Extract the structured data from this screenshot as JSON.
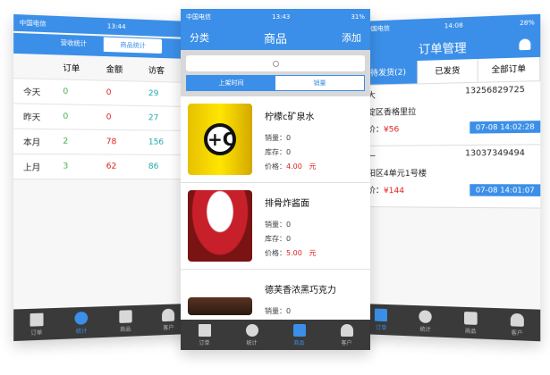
{
  "left": {
    "status": {
      "carrier": "中国电信",
      "time": "13:44"
    },
    "segment": [
      "营收统计",
      "商品统计"
    ],
    "header": [
      "",
      "订单",
      "金额",
      "访客"
    ],
    "rows": [
      {
        "label": "今天",
        "orders": "0",
        "amount": "0",
        "visitors": "29"
      },
      {
        "label": "昨天",
        "orders": "0",
        "amount": "0",
        "visitors": "27"
      },
      {
        "label": "本月",
        "orders": "2",
        "amount": "78",
        "visitors": "156"
      },
      {
        "label": "上月",
        "orders": "3",
        "amount": "62",
        "visitors": "86"
      }
    ],
    "tabs": [
      "订单",
      "统计",
      "商品",
      "客户"
    ]
  },
  "center": {
    "status": {
      "carrier": "中国电信",
      "time": "13:43",
      "battery": "31%"
    },
    "nav": {
      "left": "分类",
      "title": "商品",
      "right": "添加"
    },
    "segment": [
      "上架时间",
      "销量"
    ],
    "products": [
      {
        "name": "柠檬c矿泉水",
        "sales": "销量：0",
        "stock": "库存：0",
        "price_label": "价格：",
        "price": "4.00",
        "unit": "元"
      },
      {
        "name": "排骨炸酱面",
        "sales": "销量：0",
        "stock": "库存：0",
        "price_label": "价格：",
        "price": "5.00",
        "unit": "元"
      },
      {
        "name": "德芙香浓黑巧克力",
        "sales": "销量：0",
        "stock": "",
        "price_label": "",
        "price": "",
        "unit": ""
      }
    ],
    "tabs": [
      "订单",
      "统计",
      "商品",
      "客户"
    ]
  },
  "right": {
    "status": {
      "carrier": "中国电信",
      "time": "14:08",
      "battery": "28%"
    },
    "nav": {
      "title": "订单管理"
    },
    "tabs_top": [
      "待发货(2)",
      "已发货",
      "全部订单"
    ],
    "orders": [
      {
        "name": "王大",
        "phone": "13256829725",
        "addr": "海淀区香格里拉",
        "total_label": "总价：",
        "total": "¥56",
        "time": "07-08 14:02:28"
      },
      {
        "name": "张一",
        "phone": "13037349494",
        "addr": "朝阳区4单元1号楼",
        "total_label": "总价：",
        "total": "¥144",
        "time": "07-08 14:01:07"
      }
    ],
    "tabs": [
      "订单",
      "统计",
      "商品",
      "客户"
    ]
  },
  "colors": {
    "accent": "#3b8fe8",
    "price": "#e02020",
    "tabbar": "#3a3a3a"
  }
}
